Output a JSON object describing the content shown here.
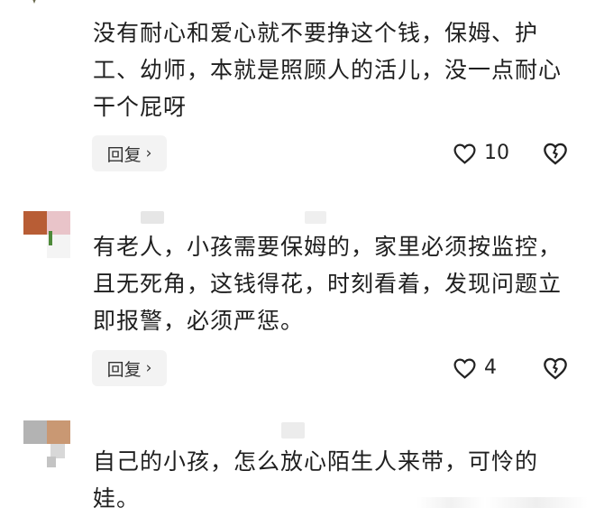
{
  "comments": [
    {
      "text": "没有耐心和爱心就不要挣这个钱，保姆、护工、幼师，本就是照顾人的活儿，没一点耐心干个屁呀",
      "reply_label": "回复",
      "likes": "10"
    },
    {
      "text": "有老人，小孩需要保姆的，家里必须按监控，且无死角，这钱得花，时刻看着，发现问题立即报警，必须严惩。",
      "reply_label": "回复",
      "likes": "4"
    },
    {
      "text": "自己的小孩，怎么放心陌生人来带，可怜的娃。"
    }
  ],
  "icons": {
    "reply_chevron": "chevron-right-icon",
    "like": "heart-outline-icon",
    "dislike": "broken-heart-icon"
  },
  "colors": {
    "text": "#1f1f1f",
    "reply_bg": "#f3f3f3",
    "icon_stroke": "#222222"
  }
}
